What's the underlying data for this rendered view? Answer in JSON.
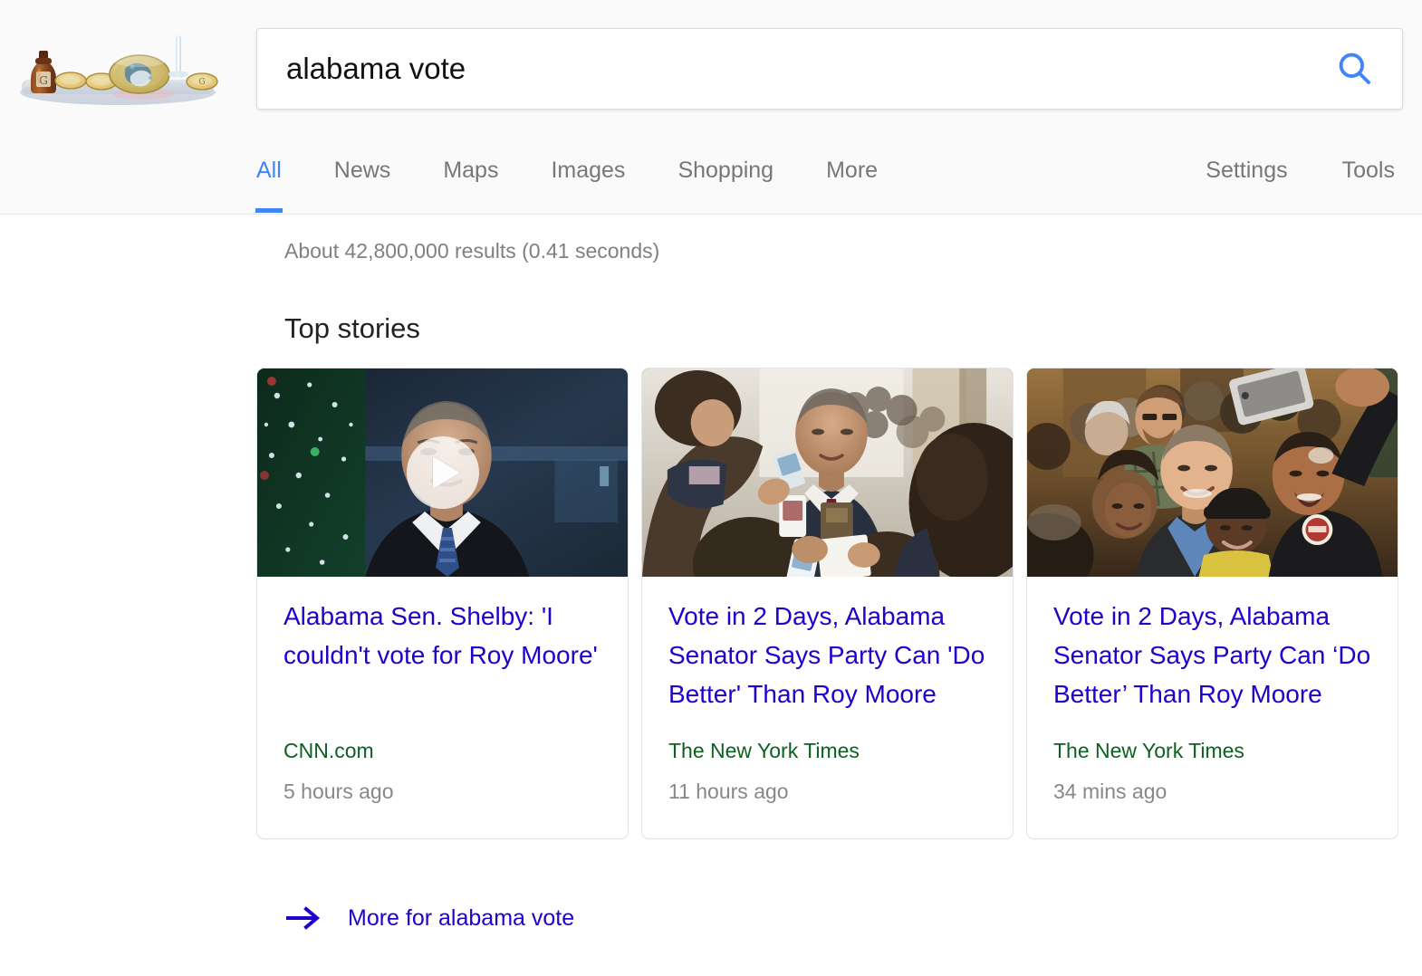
{
  "header": {
    "doodle": {
      "name": "google-doodle-science-lab",
      "alt": "Google Doodle"
    },
    "search": {
      "value": "alabama vote",
      "placeholder": "Search",
      "button_label": "Search",
      "icon": "search-icon",
      "accent": "#4285f4"
    },
    "nav_left": [
      {
        "label": "All",
        "active": true
      },
      {
        "label": "News",
        "active": false
      },
      {
        "label": "Maps",
        "active": false
      },
      {
        "label": "Images",
        "active": false
      },
      {
        "label": "Shopping",
        "active": false
      },
      {
        "label": "More",
        "active": false
      }
    ],
    "nav_right": [
      {
        "label": "Settings"
      },
      {
        "label": "Tools"
      }
    ]
  },
  "results": {
    "count_text": "About 42,800,000 results (0.41 seconds)",
    "top_stories_heading": "Top stories",
    "more_link": {
      "label": "More for alabama vote",
      "icon": "arrow-right-icon"
    },
    "cards": [
      {
        "title": "Alabama Sen. Shelby: 'I couldn't vote for Roy Moore'",
        "source": "CNN.com",
        "time": "5 hours ago",
        "has_video": true,
        "thumb_name": "thumb-shelby-interview"
      },
      {
        "title": "Vote in 2 Days, Alabama Senator Says Party Can 'Do Better' Than Roy Moore",
        "source": "The New York Times",
        "time": "11 hours ago",
        "has_video": false,
        "thumb_name": "thumb-senator-press-scrum"
      },
      {
        "title": "Vote in 2 Days, Alabama Senator Says Party Can ‘Do Better’ Than Roy Moore",
        "source": "The New York Times",
        "time": "34 mins ago",
        "has_video": false,
        "thumb_name": "thumb-crowd-selfie"
      }
    ]
  },
  "colors": {
    "link": "#2200cc",
    "source_green": "#0c6120",
    "muted": "#888888",
    "accent_blue": "#4285f4"
  }
}
